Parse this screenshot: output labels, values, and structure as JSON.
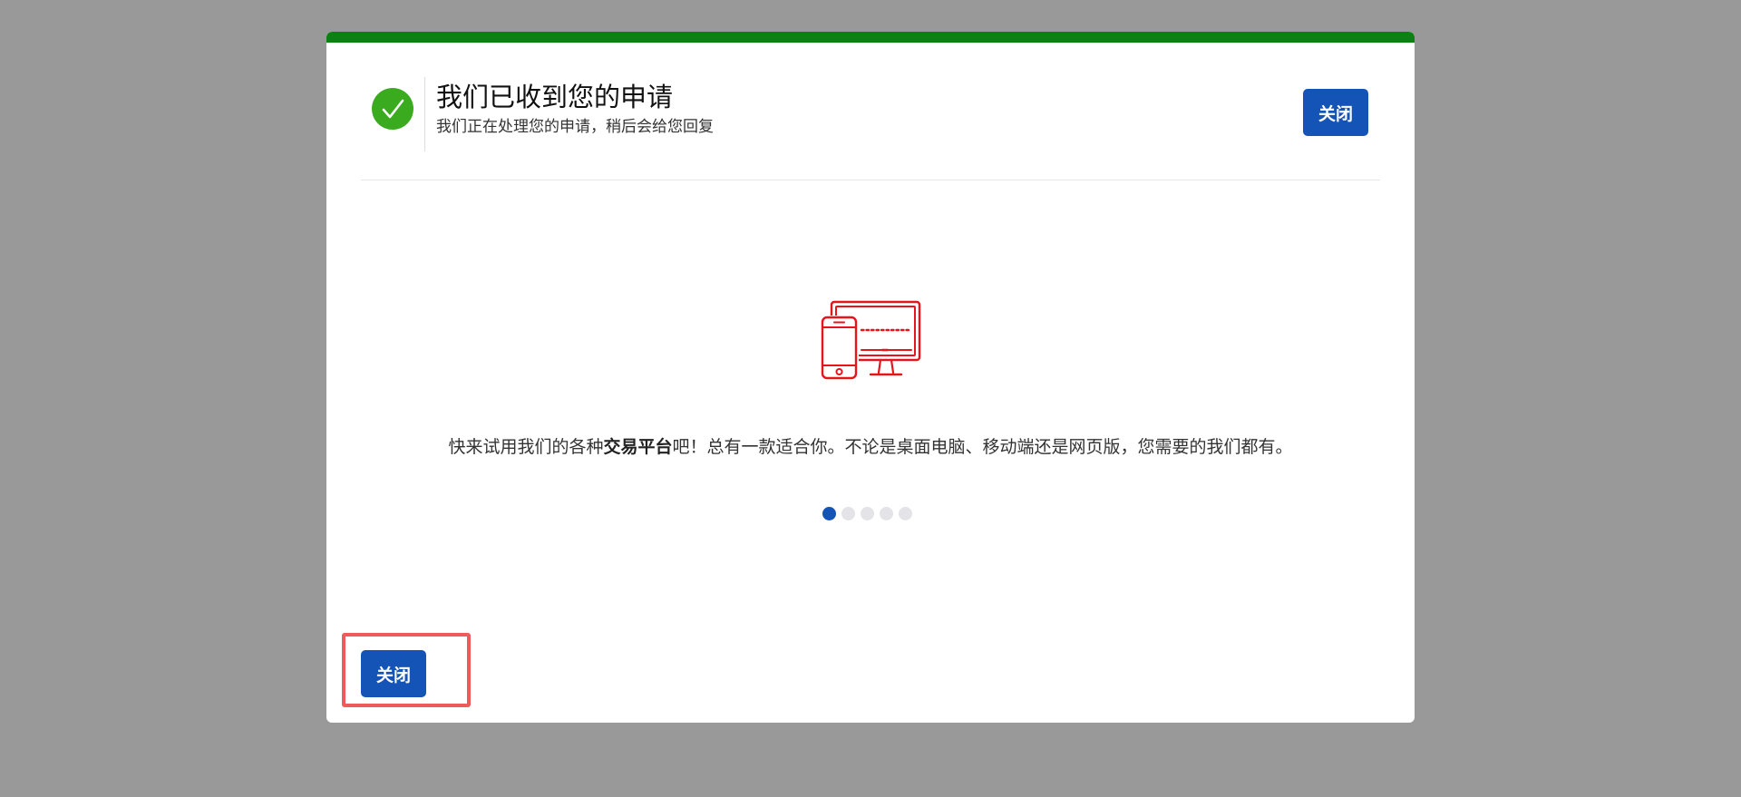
{
  "colors": {
    "progress_bar": "#0a8211",
    "success_circle": "#3aaa1f",
    "primary_button": "#1554b7",
    "icon_stroke": "#e8141c",
    "highlight_border": "#ef5a5a",
    "dot_active": "#1554b7",
    "dot_inactive": "#e4e4e8"
  },
  "header": {
    "title": "我们已收到您的申请",
    "subtitle": "我们正在处理您的申请，稍后会给您回复",
    "close_label": "关闭",
    "icon": "check-circle-icon"
  },
  "carousel": {
    "icon": "devices-icon",
    "message_before": "快来试用我们的各种",
    "message_bold": "交易平台",
    "message_after": "吧！总有一款适合你。不论是桌面电脑、移动端还是网页版，您需要的我们都有。",
    "slide_count": 5,
    "active_index": 0
  },
  "footer": {
    "close_label": "关闭"
  }
}
